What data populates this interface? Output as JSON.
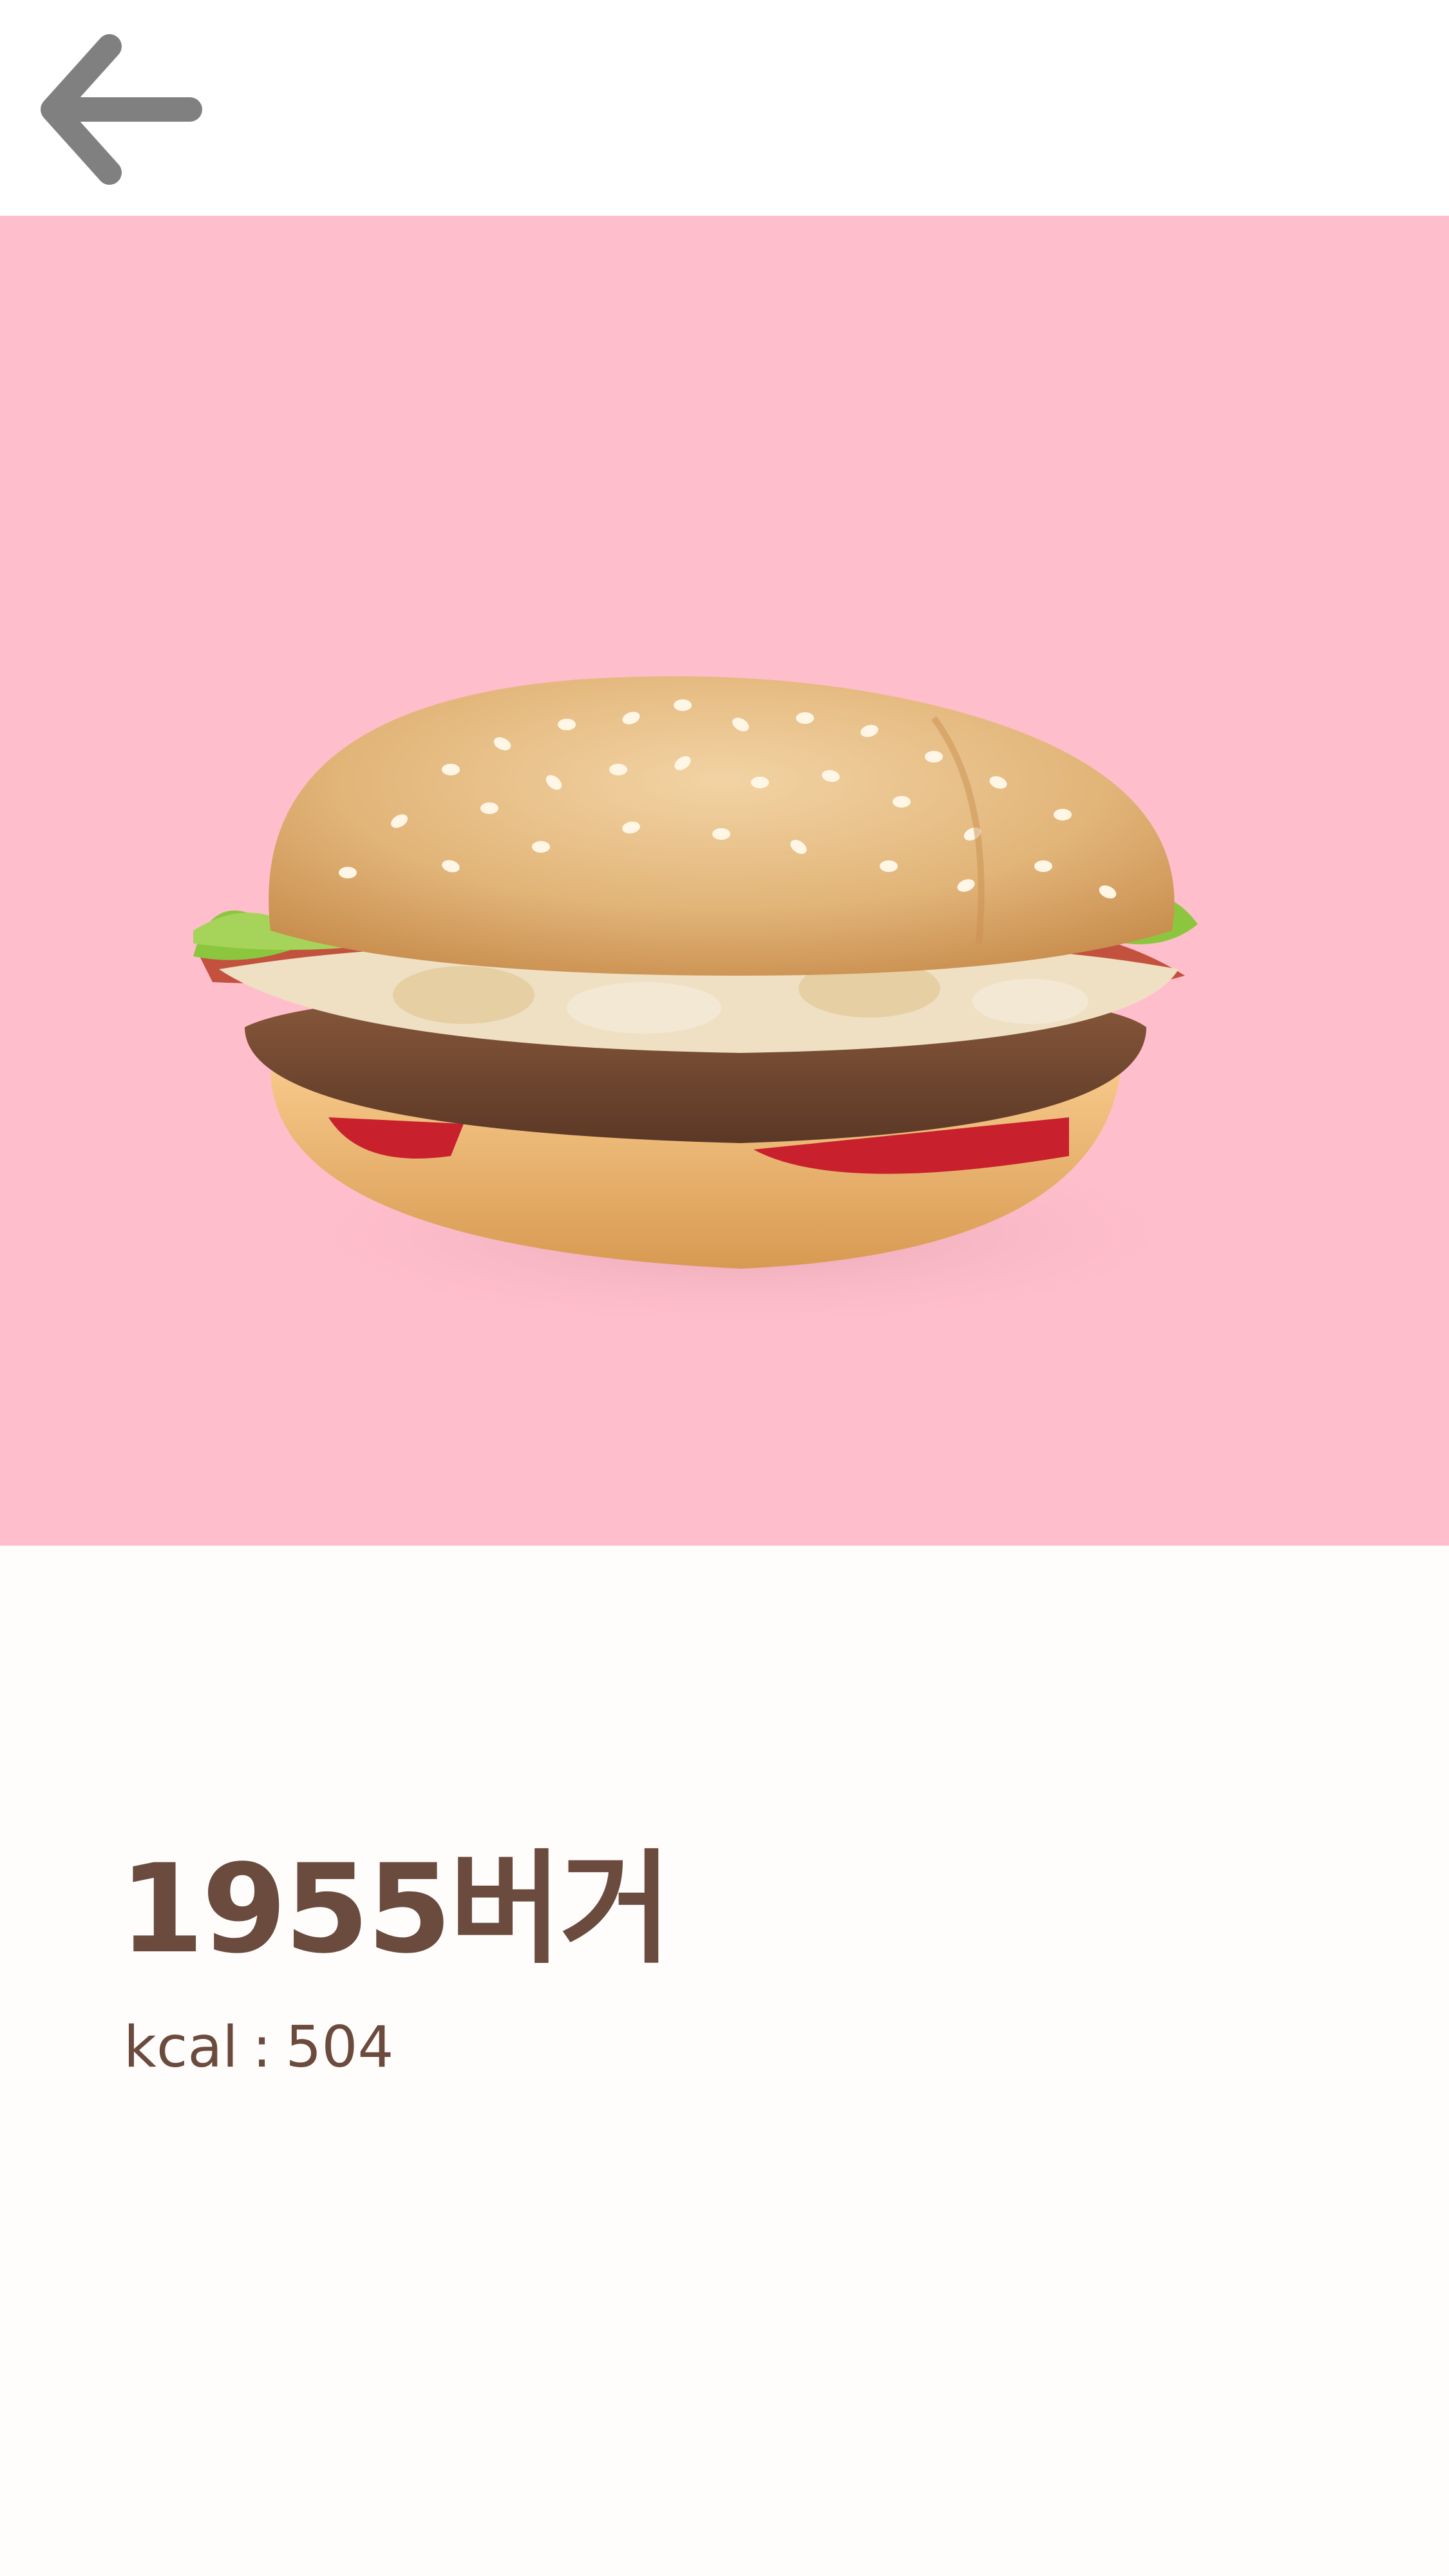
{
  "header": {
    "back_icon": "arrow-left-icon",
    "icon_color": "#808080"
  },
  "hero": {
    "background_color": "#ffbecb",
    "image": "burger-image"
  },
  "product": {
    "name": "1955버거",
    "kcal_label": "kcal",
    "kcal_separator": ":",
    "kcal_value": "504",
    "text_color": "#6b4b3e"
  }
}
